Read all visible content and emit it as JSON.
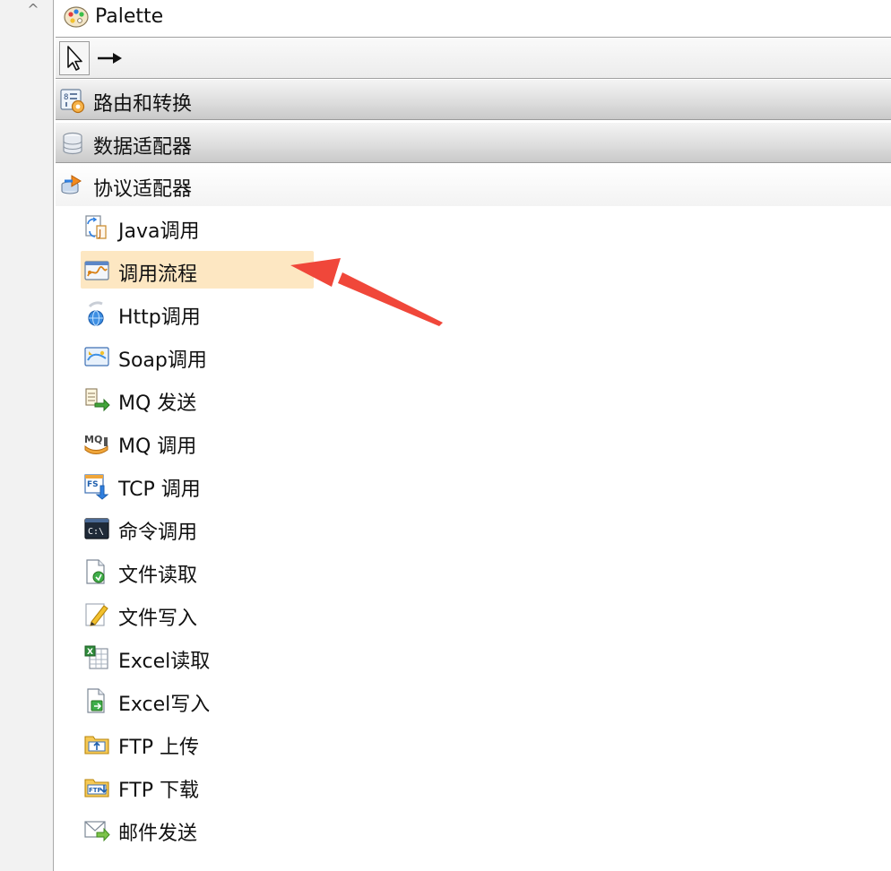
{
  "palette": {
    "title": "Palette",
    "collapse_glyph": "^"
  },
  "tools": {
    "select": "select-tool",
    "connection": "connection-tool"
  },
  "drawers": [
    {
      "label": "路由和转换",
      "icon": "routing-transform-icon",
      "state": "closed"
    },
    {
      "label": "数据适配器",
      "icon": "database-icon",
      "state": "closed"
    },
    {
      "label": "协议适配器",
      "icon": "protocol-adapter-icon",
      "state": "open"
    }
  ],
  "entries": [
    {
      "label": "Java调用",
      "icon": "java-call-icon"
    },
    {
      "label": "调用流程",
      "icon": "call-flow-icon",
      "selected": true
    },
    {
      "label": "Http调用",
      "icon": "http-call-icon"
    },
    {
      "label": "Soap调用",
      "icon": "soap-call-icon"
    },
    {
      "label": "MQ 发送",
      "icon": "mq-send-icon"
    },
    {
      "label": "MQ 调用",
      "icon": "mq-call-icon"
    },
    {
      "label": "TCP 调用",
      "icon": "tcp-call-icon"
    },
    {
      "label": "命令调用",
      "icon": "command-call-icon"
    },
    {
      "label": "文件读取",
      "icon": "file-read-icon"
    },
    {
      "label": "文件写入",
      "icon": "file-write-icon"
    },
    {
      "label": "Excel读取",
      "icon": "excel-read-icon"
    },
    {
      "label": "Excel写入",
      "icon": "excel-write-icon"
    },
    {
      "label": "FTP 上传",
      "icon": "ftp-upload-icon"
    },
    {
      "label": "FTP 下载",
      "icon": "ftp-download-icon"
    },
    {
      "label": "邮件发送",
      "icon": "mail-send-icon"
    }
  ],
  "colors": {
    "selection": "#fde7c2",
    "annotation_arrow": "#f0473a"
  }
}
